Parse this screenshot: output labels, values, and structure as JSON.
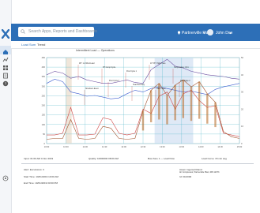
{
  "search": {
    "placeholder": "Search Apps, Reports and Dashboards"
  },
  "header": {
    "plant": "Partnerville Plant",
    "user": "John Doe"
  },
  "tabs": [
    {
      "label": "Load Sum"
    },
    {
      "label": "Trend"
    }
  ],
  "chart_title": "Intermittent Load — Operations",
  "chart_data": {
    "type": "line",
    "x_ticks": [
      "10:00",
      "10:30",
      "11:00",
      "11:30",
      "12:00",
      "12:30",
      "13:00",
      "13:30",
      "14:00",
      "14:30",
      "15:00"
    ],
    "y_left_ticks": [
      "0",
      "50",
      "100",
      "150",
      "200",
      "250",
      "300",
      "350",
      "400",
      "450"
    ],
    "y_right_ticks": [
      "0",
      "10",
      "20",
      "30",
      "40",
      "50"
    ],
    "series": [
      {
        "color": "#3f5fd0",
        "values": [
          70,
          75,
          72,
          60,
          58,
          55,
          56,
          54,
          52,
          53,
          58,
          62,
          60,
          64,
          66,
          64,
          62,
          60,
          61,
          59,
          57,
          63,
          66,
          68,
          70
        ]
      },
      {
        "color": "#d04848",
        "values": [
          10,
          10,
          12,
          42,
          10,
          10,
          11,
          30,
          28,
          12,
          10,
          12,
          40,
          35,
          55,
          60,
          40,
          58,
          62,
          50,
          42,
          44,
          12,
          10,
          8
        ]
      },
      {
        "color": "#a0522d",
        "values": [
          5,
          6,
          6,
          28,
          6,
          5,
          6,
          20,
          18,
          6,
          5,
          6,
          38,
          62,
          70,
          56,
          68,
          74,
          66,
          72,
          58,
          48,
          14,
          8,
          6
        ]
      },
      {
        "color": "#6b4fa0",
        "values": [
          80,
          84,
          82,
          76,
          78,
          74,
          72,
          70,
          70,
          72,
          74,
          71,
          70,
          86,
          92,
          98,
          90,
          88,
          84,
          82,
          80,
          79,
          78,
          76,
          75
        ]
      }
    ],
    "annotations": [
      {
        "text": "WT: 1.2 Wind Load"
      },
      {
        "text": "RT Comp Cycle"
      },
      {
        "text": "Post Cycle 1"
      },
      {
        "text": "AT T/P: High Press"
      },
      {
        "text": "Temperature: 43.1"
      },
      {
        "text": "Shutdown Event"
      },
      {
        "text": "Post Cycle 2"
      },
      {
        "text": "Heat Recovery"
      },
      {
        "text": "Valve Open"
      },
      {
        "text": "Fan Stage 2"
      }
    ]
  },
  "footer": {
    "row1_left": "Input: 01:00 AM 4 Nov 2019",
    "row1_mid": "Quality: 10000000 08:00 AM",
    "row1_right": "Bus Zone 1 — Load Flow",
    "row1_far": "Load Curve: 15 min avg",
    "row2_left": "Alert: Excursions: 3",
    "row2_right_a": "Asset: Ingersoll Rand",
    "row2_right_b": "Air Compressor, Partnerville Plant, MP-12373",
    "row3_left": "Start Time: 10/01/2019 10:00 AM",
    "row3_right": "Id: 00-0000",
    "row4_left": "End Time: 10/01/2019 03:00 PM"
  }
}
